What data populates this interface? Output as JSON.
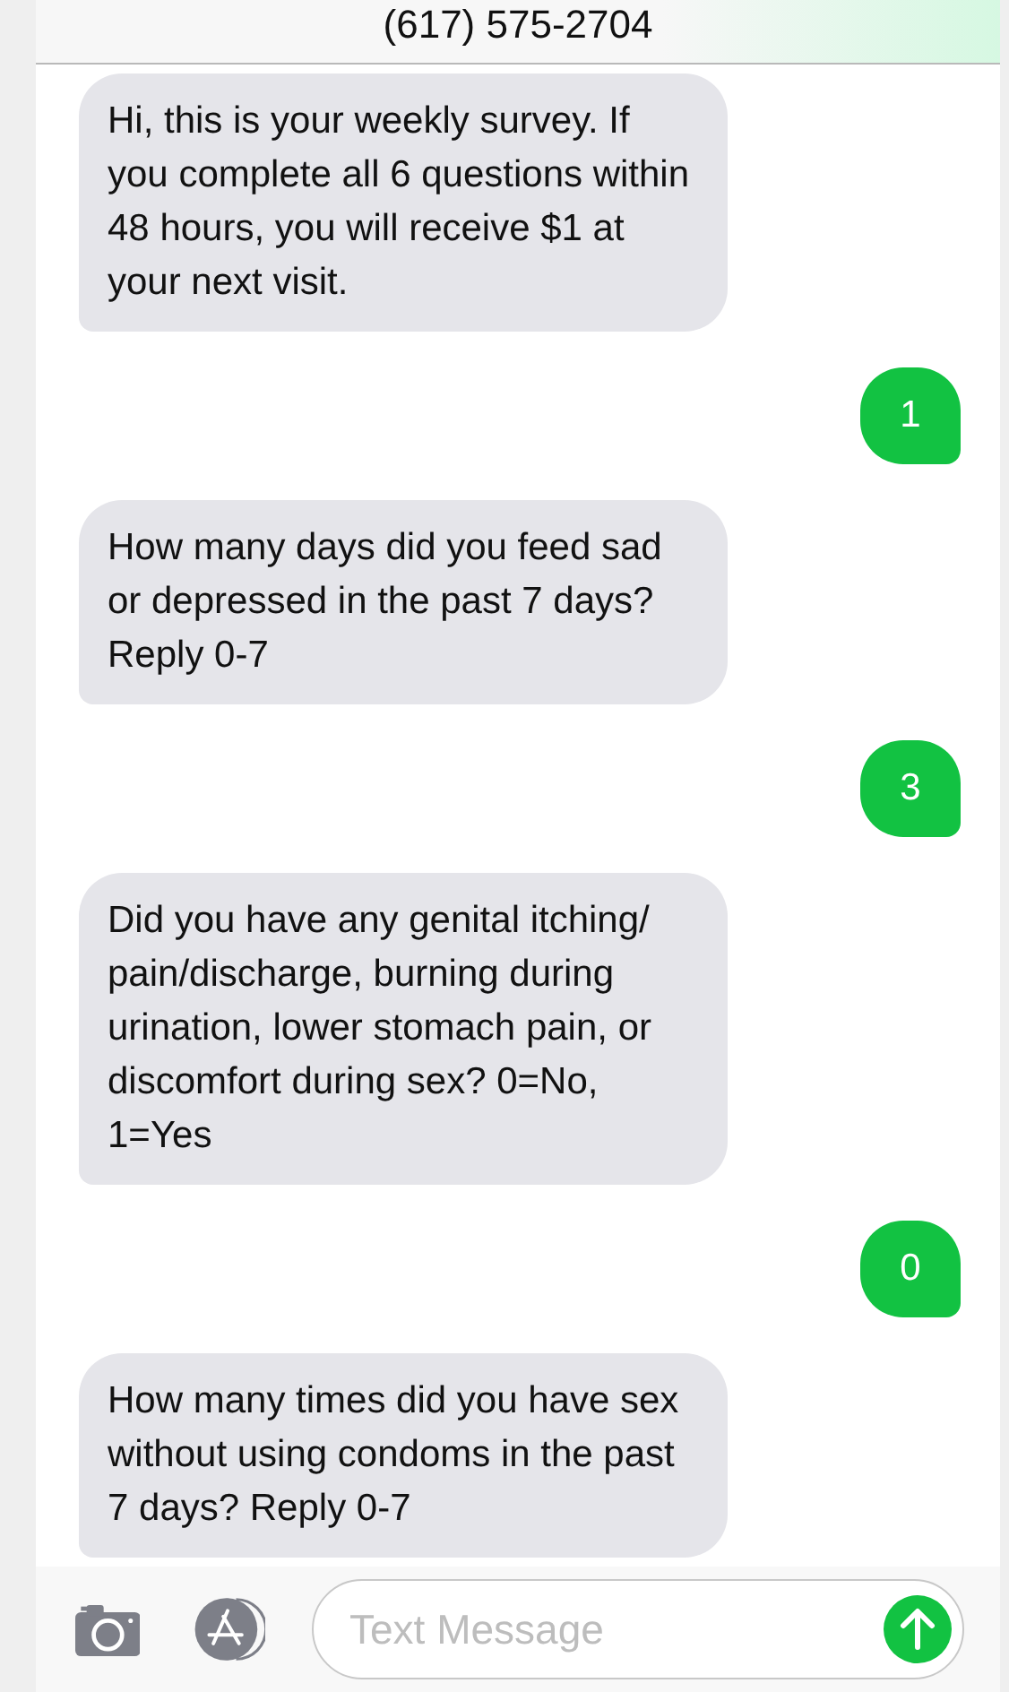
{
  "header": {
    "title": "(617) 575-2704"
  },
  "messages": [
    {
      "kind": "incoming",
      "text": "Hi, this is your weekly survey. If you complete all 6 questions within 48 hours, you will receive $1 at your next visit."
    },
    {
      "kind": "outgoing",
      "text": "1"
    },
    {
      "kind": "incoming",
      "text": "How many days did you feed sad or depressed in the past 7 days? Reply 0-7"
    },
    {
      "kind": "outgoing",
      "text": "3"
    },
    {
      "kind": "incoming",
      "text": "Did you have any genital itching/ pain/discharge, burning during urination, lower stomach pain, or discomfort during sex? 0=No, 1=Yes"
    },
    {
      "kind": "outgoing",
      "text": "0"
    },
    {
      "kind": "incoming",
      "text": "How many times did you have sex without using condoms in the past 7 days? Reply 0-7"
    }
  ],
  "composer": {
    "placeholder": "Text Message"
  }
}
